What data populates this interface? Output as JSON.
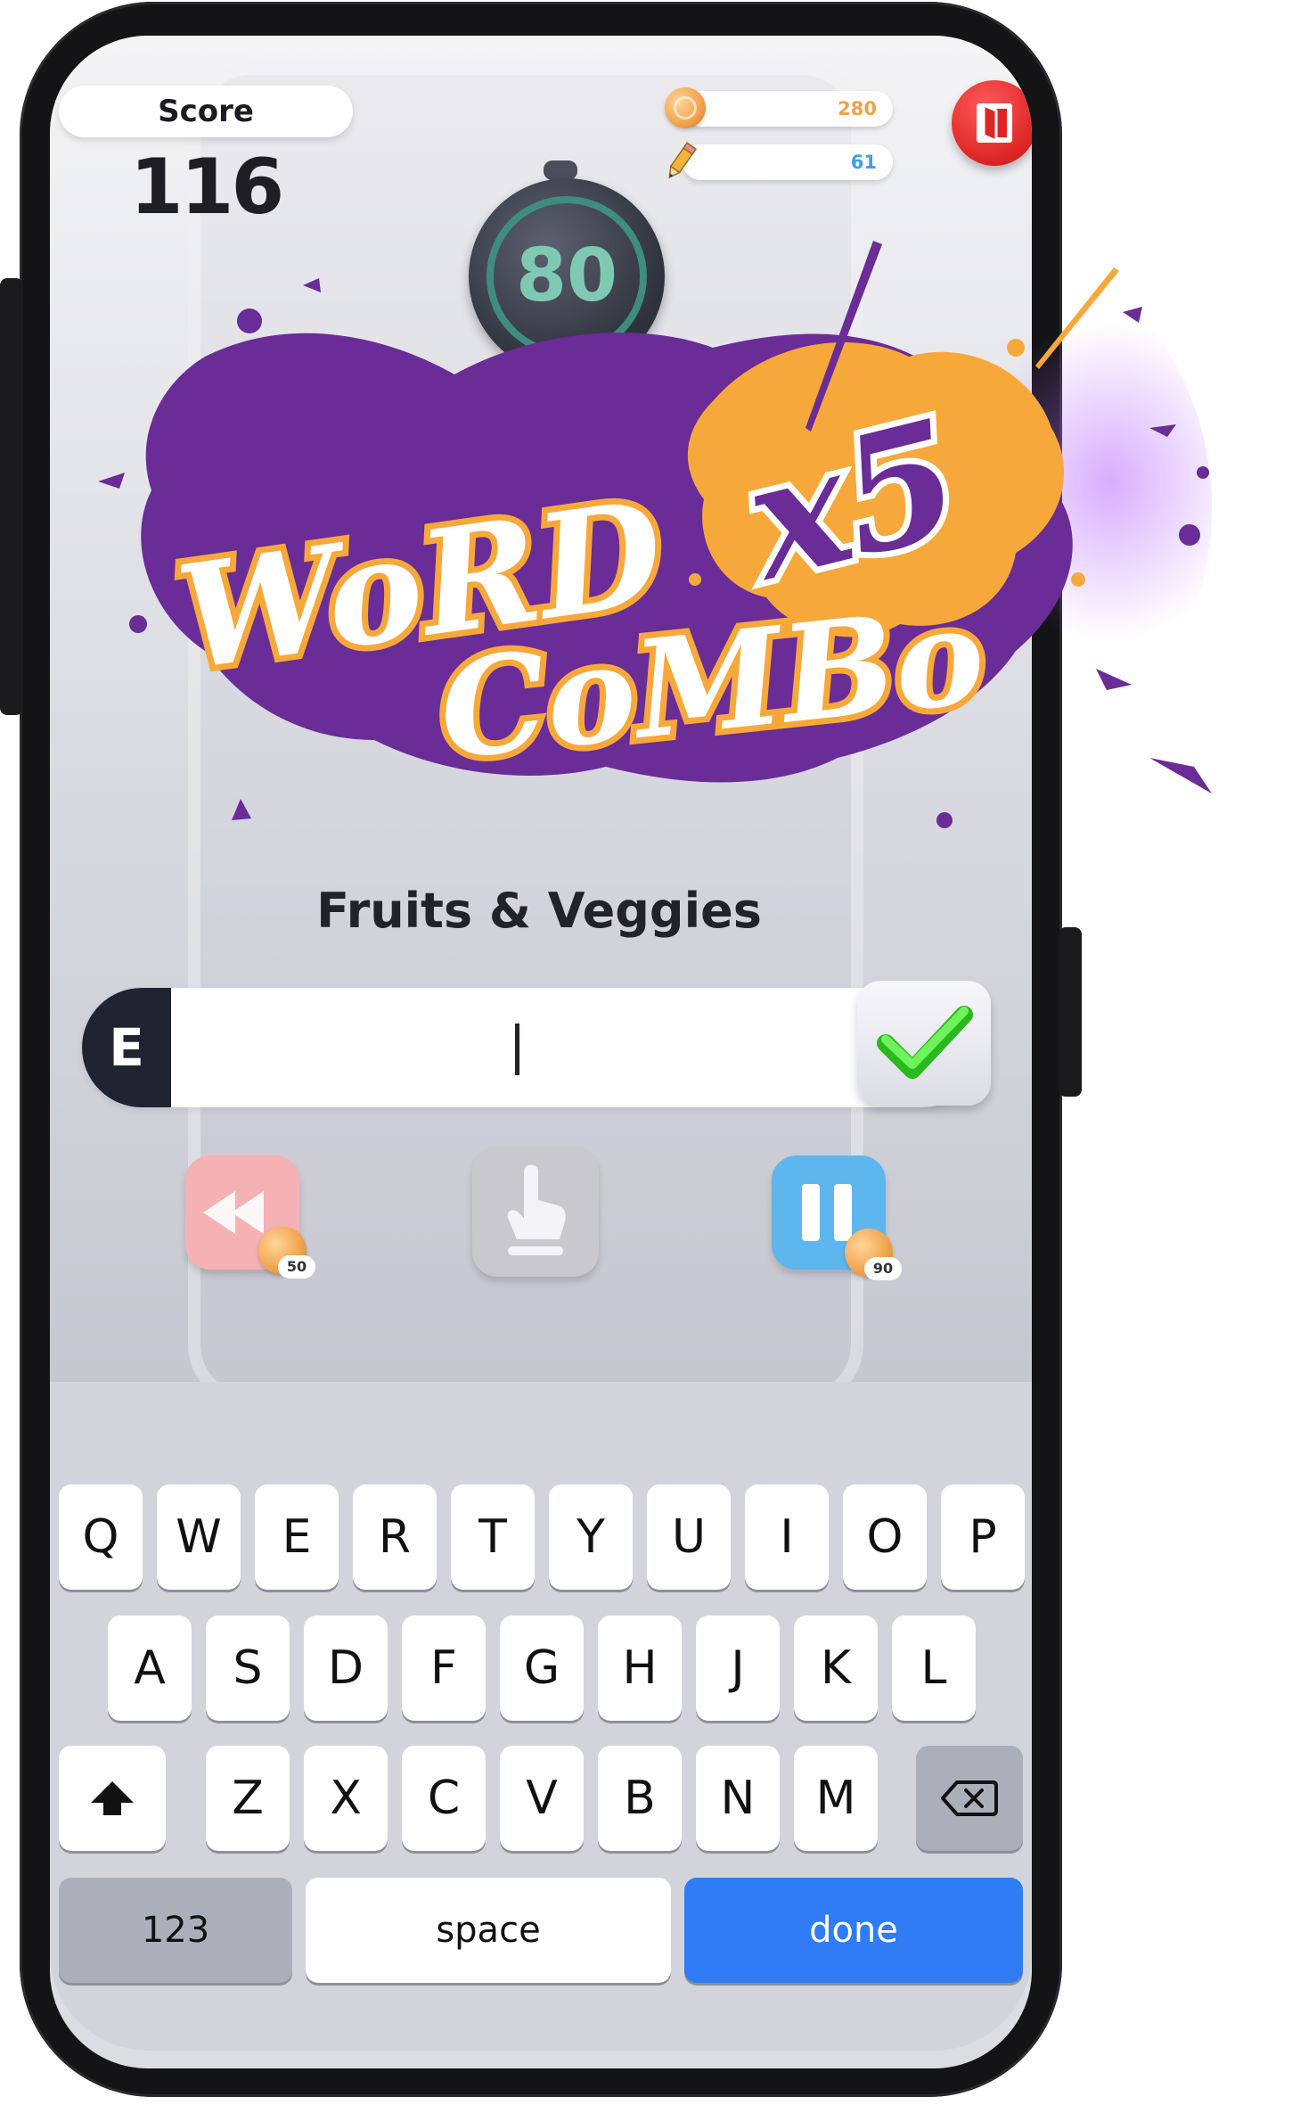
{
  "score": {
    "label": "Score",
    "value": "116"
  },
  "currencies": {
    "coins": {
      "value": "280",
      "icon": "coin-icon",
      "color": "#f0a24a"
    },
    "pencils": {
      "value": "61",
      "icon": "pencil-icon",
      "color": "#3aa0e8"
    }
  },
  "exit_button": {
    "icon": "exit-door-icon"
  },
  "timer": {
    "value": "80"
  },
  "combo": {
    "title_line1": "WoRD",
    "title_line2": "CoMBo",
    "multiplier": "x5"
  },
  "category": "Fruits & Veggies",
  "input": {
    "first_letter": "E",
    "value": ""
  },
  "submit": {
    "icon": "checkmark-icon"
  },
  "powerups": [
    {
      "name": "rewind",
      "icon": "rewind-icon",
      "cost": "50",
      "color": "#f6b1b4"
    },
    {
      "name": "hint",
      "icon": "hand-tap-icon",
      "cost": "",
      "color": "#c9c9cd"
    },
    {
      "name": "pause",
      "icon": "pause-icon",
      "cost": "90",
      "color": "#5eb6ef"
    }
  ],
  "keyboard": {
    "row1": [
      "Q",
      "W",
      "E",
      "R",
      "T",
      "Y",
      "U",
      "I",
      "O",
      "P"
    ],
    "row2": [
      "A",
      "S",
      "D",
      "F",
      "G",
      "H",
      "J",
      "K",
      "L"
    ],
    "row3": [
      "Z",
      "X",
      "C",
      "V",
      "B",
      "N",
      "M"
    ],
    "numbers_label": "123",
    "space_label": "space",
    "done_label": "done",
    "accent": "#2f7cf6"
  }
}
